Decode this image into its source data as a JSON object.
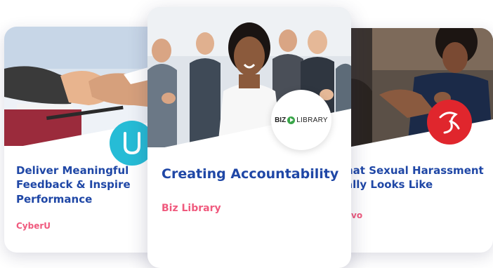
{
  "courses": [
    {
      "title": "Deliver Meaningful Feedback & Inspire Performance",
      "provider": "CyberU",
      "badge_color": "#26bcd6",
      "icon": "cyberu-logo-icon"
    },
    {
      "title": "Creating Accountability",
      "provider": "Biz Library",
      "badge_color": "#ffffff",
      "icon": "bizlibrary-logo-icon",
      "logo_text_left": "BIZ",
      "logo_text_right": "LIBRARY"
    },
    {
      "title": "hat Sexual Harassment ally Looks Like",
      "title_line1": "hat Sexual Harassment",
      "title_line2": "ally Looks Like",
      "provider": "vo",
      "badge_color": "#e0262d",
      "icon": "provider-logo-icon"
    }
  ],
  "colors": {
    "title": "#1f47a6",
    "provider": "#f05a7e"
  }
}
